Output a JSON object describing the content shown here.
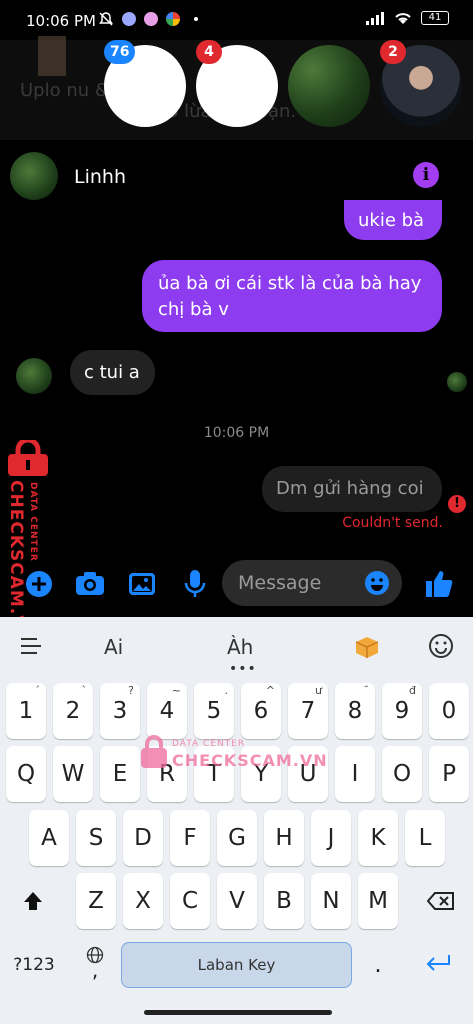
{
  "status_bar": {
    "time": "10:06 PM",
    "battery": "41"
  },
  "chat_heads": {
    "ghost_text_line1": "Uplo        nu         &         ná",
    "ghost_text_line2": "đó lừa đảo bạn.",
    "badges": [
      "76",
      "4",
      "2"
    ],
    "badge_colors": {
      "blue": "#1b84ff",
      "red": "#e0282f"
    }
  },
  "header": {
    "name": "Linhh",
    "info_glyph": "i"
  },
  "messages": {
    "outgoing_top": "ukie bà",
    "outgoing_main": "ủa bà ơi cái stk là của bà hay chị bà v",
    "incoming": "c tui a",
    "timestamp": "10:06 PM",
    "failed": "Dm gửi hàng coi",
    "failed_status": "Couldn't send."
  },
  "composer": {
    "placeholder": "Message"
  },
  "watermark": {
    "side_small": "DATA CENTER",
    "side_big": "CHECKSCAM.VN",
    "center_small": "DATA CENTER",
    "center_big": "CHECKSCAM.VN"
  },
  "keyboard": {
    "suggestions": [
      "Ai",
      "Àh"
    ],
    "number_row": [
      {
        "k": "1",
        "a": "ˊ"
      },
      {
        "k": "2",
        "a": "ˋ"
      },
      {
        "k": "3",
        "a": "?"
      },
      {
        "k": "4",
        "a": "~"
      },
      {
        "k": "5",
        "a": "."
      },
      {
        "k": "6",
        "a": "^"
      },
      {
        "k": "7",
        "a": "ư"
      },
      {
        "k": "8",
        "a": "˘"
      },
      {
        "k": "9",
        "a": "đ"
      },
      {
        "k": "0",
        "a": ""
      }
    ],
    "row1": [
      "Q",
      "W",
      "E",
      "R",
      "T",
      "Y",
      "U",
      "I",
      "O",
      "P"
    ],
    "row2": [
      "A",
      "S",
      "D",
      "F",
      "G",
      "H",
      "J",
      "K",
      "L"
    ],
    "row3": [
      "Z",
      "X",
      "C",
      "V",
      "B",
      "N",
      "M"
    ],
    "symbols_key": "?123",
    "comma_key": ",",
    "space_label": "Laban Key",
    "period_key": "."
  },
  "colors": {
    "accent_purple": "#8d3cf0",
    "messenger_blue": "#1b84ff",
    "error_red": "#e0282f"
  }
}
